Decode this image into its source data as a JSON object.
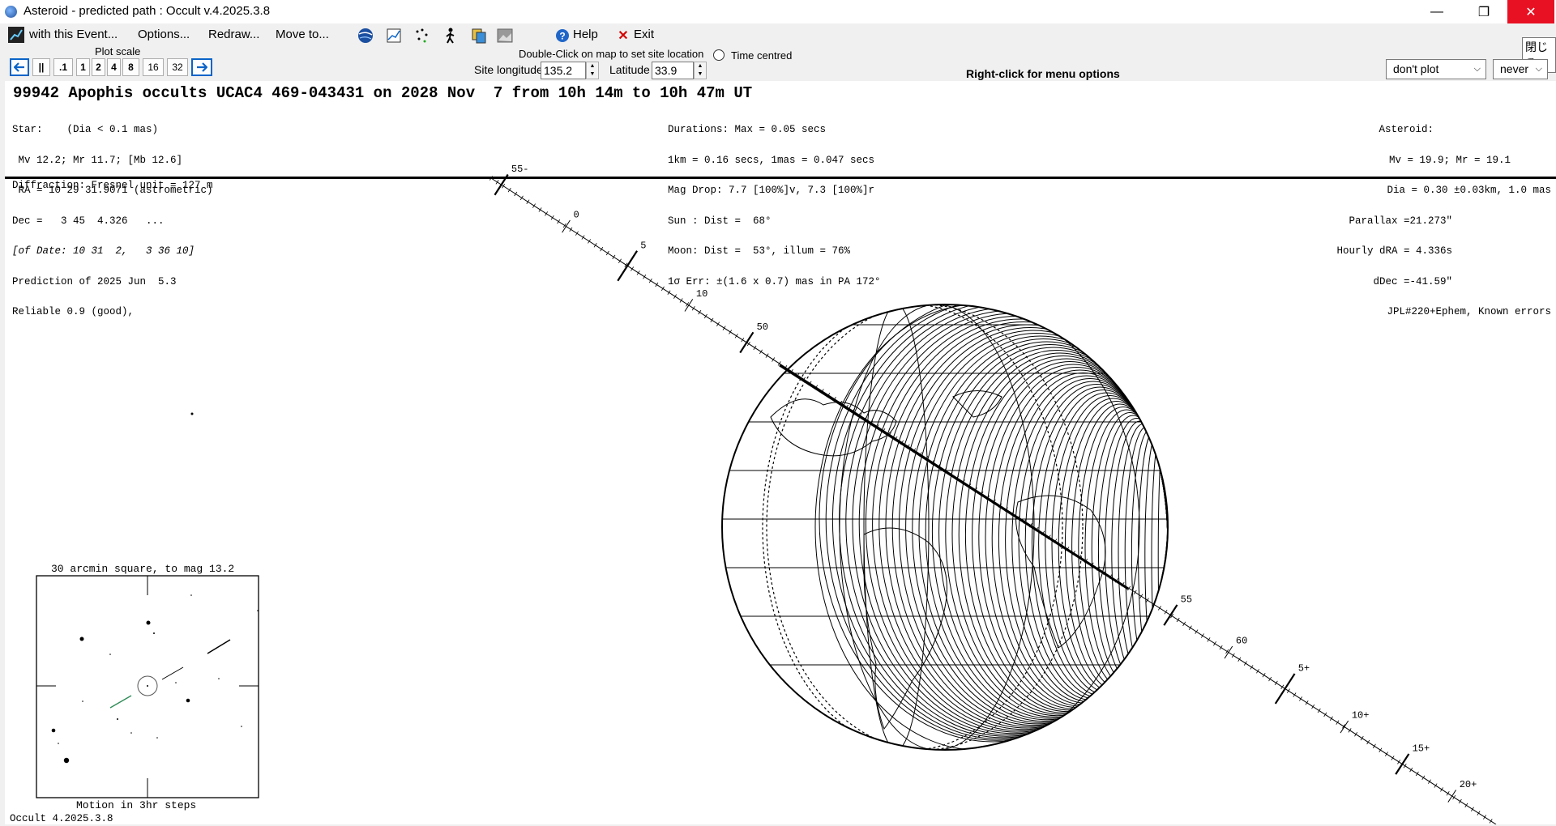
{
  "window": {
    "title": "Asteroid - predicted path : Occult v.4.2025.3.8",
    "controls": {
      "minimize": "—",
      "maximize": "❐",
      "close": "✕"
    }
  },
  "menu": {
    "items": [
      "with this Event...",
      "Options...",
      "Redraw...",
      "Move to..."
    ],
    "toolbar_icons": [
      "globe-icon",
      "chart-icon",
      "scatter-icon",
      "walker-icon",
      "copy-icon",
      "image-icon"
    ],
    "help": "Help",
    "exit": "Exit"
  },
  "tooltip": "閉じる",
  "plot_scale": {
    "label": "Plot scale",
    "buttons": [
      ".1",
      "1",
      "2",
      "4",
      "8",
      "16",
      "32"
    ],
    "pause": "||"
  },
  "site": {
    "hint": "Double-Click on map to set site location",
    "time_centred": "Time centred",
    "longitude_label": "Site longitude",
    "longitude": "135.2",
    "latitude_label": "Latitude",
    "latitude": "33.9"
  },
  "right_click_hint": "Right-click for menu options",
  "plot_option": "don't plot",
  "never_option": "never",
  "event": {
    "headline": "99942 Apophis occults UCAC4 469-043431 on 2028 Nov  7 from 10h 14m to 10h 47m UT",
    "star_lines": [
      "Star:    (Dia < 0.1 mas)",
      " Mv 12.2; Mr 11.7; [Mb 12.6]",
      " RA = 10 29 31.9071 (astrometric)",
      "Dec =   3 45  4.326   ...",
      "[of Date: 10 31  2,   3 36 10]",
      "Prediction of 2025 Jun  5.3",
      "Reliable 0.9 (good),"
    ],
    "duration_lines": [
      "Durations: Max = 0.05 secs",
      "1km = 0.16 secs, 1mas = 0.047 secs",
      "Mag Drop: 7.7 [100%]v, 7.3 [100%]r",
      "Sun : Dist =  68°",
      "Moon: Dist =  53°, illum = 76%",
      "1σ Err: ±(1.6 x 0.7) mas in PA 172°"
    ],
    "asteroid_lines": [
      "Asteroid:",
      "Mv = 19.9; Mr = 19.1",
      "Dia = 0.30 ±0.03km, 1.0 mas",
      "Parallax =21.273\"",
      "Hourly dRA = 4.336s",
      "dDec =-41.59\"",
      "JPL#220+Ephem, Known errors"
    ],
    "diffraction": "Diffraction: Fresnel unit = 127 m"
  },
  "track_labels": [
    "55-",
    "0",
    "5",
    "10",
    "50",
    "55",
    "60",
    "5+",
    "10+",
    "15+",
    "20+"
  ],
  "starchart": {
    "title": "30 arcmin square, to mag 13.2",
    "caption": "Motion in 3hr steps"
  },
  "footer": "Occult 4.2025.3.8",
  "colors": {
    "close_bg": "#e81123",
    "arrow_blue": "#0a64c8",
    "motion_green": "#2e8b57"
  }
}
